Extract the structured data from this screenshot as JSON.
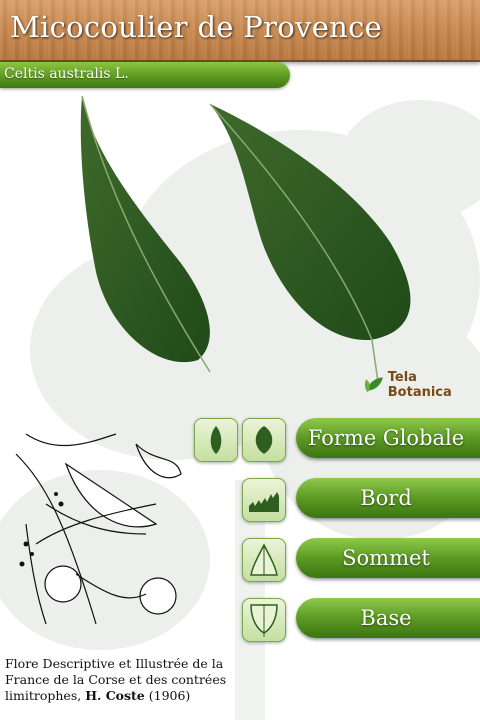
{
  "header": {
    "title": "Micocoulier de Provence"
  },
  "species": {
    "latin_name": "Celtis australis L."
  },
  "logo": {
    "text": "Tela Botanica"
  },
  "menu": {
    "items": [
      {
        "label": "Forme Globale"
      },
      {
        "label": "Bord"
      },
      {
        "label": "Sommet"
      },
      {
        "label": "Base"
      }
    ]
  },
  "caption": {
    "text": "Flore Descriptive et Illustrée de la France de la Corse et des contrées limitrophes, ",
    "author": "H. Coste",
    "year": " (1906)"
  },
  "colors": {
    "accent_green": "#5c9a24",
    "wood": "#c98a52"
  },
  "icons": [
    "leaf-shape-narrow-icon",
    "leaf-shape-wide-icon",
    "leaf-edge-icon",
    "leaf-apex-icon",
    "leaf-base-icon"
  ]
}
